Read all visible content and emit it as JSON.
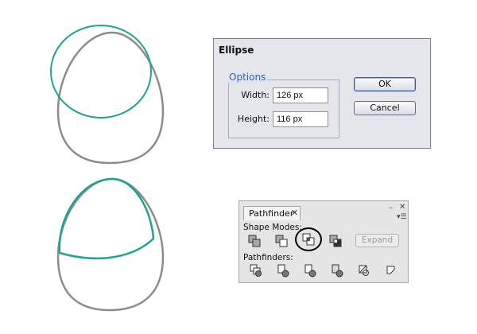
{
  "dialog": {
    "title": "Ellipse",
    "options_legend": "Options",
    "width_label": "Width:",
    "width_value": "126 px",
    "height_label": "Height:",
    "height_value": "116 px",
    "ok_label": "OK",
    "cancel_label": "Cancel"
  },
  "pathfinder": {
    "tab_title": "Pathfinder",
    "shape_modes_label": "Shape Modes:",
    "pathfinders_label": "Pathfinders:",
    "expand_label": "Expand",
    "shape_mode_icons": [
      "unite-icon",
      "minus-front-icon",
      "intersect-icon",
      "exclude-icon"
    ],
    "pathfinder_icons": [
      "divide-icon",
      "trim-icon",
      "merge-icon",
      "crop-icon",
      "outline-icon",
      "minus-back-icon"
    ]
  },
  "colors": {
    "teal_stroke": "#1aa394",
    "gray_stroke": "#8c8c8c",
    "accent_blue": "#2b5fc7"
  }
}
